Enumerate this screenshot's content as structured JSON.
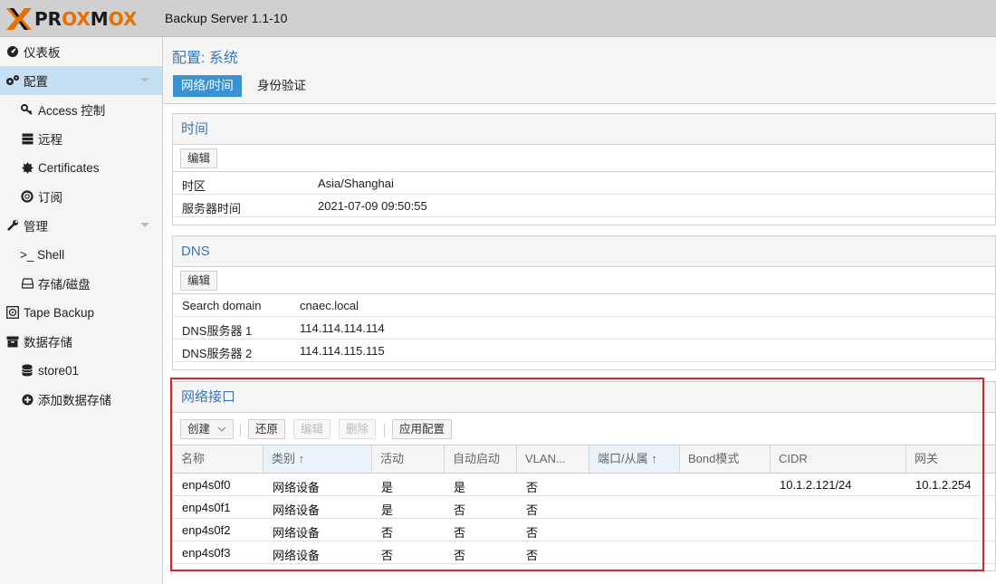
{
  "header": {
    "logo_letters": [
      "P",
      "R",
      "O",
      "X",
      "M",
      "O",
      "X"
    ],
    "product": "Backup Server 1.1-10",
    "brand_color": "#e57000"
  },
  "sidebar": {
    "items": [
      {
        "label": "仪表板",
        "icon": "dashboard-icon"
      },
      {
        "label": "配置",
        "icon": "gears-icon",
        "selected": true
      },
      {
        "label": "Access 控制",
        "icon": "key-icon"
      },
      {
        "label": "远程",
        "icon": "server-icon"
      },
      {
        "label": "Certificates",
        "icon": "certificate-icon"
      },
      {
        "label": "订阅",
        "icon": "support-icon"
      },
      {
        "label": "管理",
        "icon": "wrench-icon"
      },
      {
        "label": ">_ Shell",
        "icon": "terminal-icon"
      },
      {
        "label": "存储/磁盘",
        "icon": "hdd-icon"
      },
      {
        "label": "Tape Backup",
        "icon": "tape-icon"
      },
      {
        "label": "数据存储",
        "icon": "archive-icon"
      },
      {
        "label": "store01",
        "icon": "database-icon"
      },
      {
        "label": "添加数据存储",
        "icon": "plus-circle-icon"
      }
    ]
  },
  "main": {
    "title": "配置: 系统",
    "tabs": [
      {
        "label": "网络/时间",
        "active": true
      },
      {
        "label": "身份验证",
        "active": false
      }
    ],
    "time_panel": {
      "title": "时间",
      "edit_label": "编辑",
      "rows": [
        {
          "key": "时区",
          "value": "Asia/Shanghai"
        },
        {
          "key": "服务器时间",
          "value": "2021-07-09 09:50:55"
        }
      ]
    },
    "dns_panel": {
      "title": "DNS",
      "edit_label": "编辑",
      "rows": [
        {
          "key": "Search domain",
          "value": "cnaec.local"
        },
        {
          "key": "DNS服务器 1",
          "value": "114.114.114.114"
        },
        {
          "key": "DNS服务器 2",
          "value": "114.114.115.115"
        }
      ]
    },
    "network_panel": {
      "title": "网络接口",
      "toolbar": {
        "create": "创建",
        "revert": "还原",
        "edit": "编辑",
        "remove": "删除",
        "apply": "应用配置"
      },
      "columns": [
        "名称",
        "类别 ↑",
        "活动",
        "自动启动",
        "VLAN...",
        "端口/从属 ↑",
        "Bond模式",
        "CIDR",
        "网关"
      ],
      "rows": [
        [
          "enp4s0f0",
          "网络设备",
          "是",
          "是",
          "否",
          "",
          "",
          "10.1.2.121/24",
          "10.1.2.254"
        ],
        [
          "enp4s0f1",
          "网络设备",
          "是",
          "否",
          "否",
          "",
          "",
          "",
          ""
        ],
        [
          "enp4s0f2",
          "网络设备",
          "否",
          "否",
          "否",
          "",
          "",
          "",
          ""
        ],
        [
          "enp4s0f3",
          "网络设备",
          "否",
          "否",
          "否",
          "",
          "",
          "",
          ""
        ]
      ]
    }
  },
  "colors": {
    "accent": "#3892d4",
    "title_blue": "#3a78b5",
    "highlight_red": "#d0262c"
  }
}
